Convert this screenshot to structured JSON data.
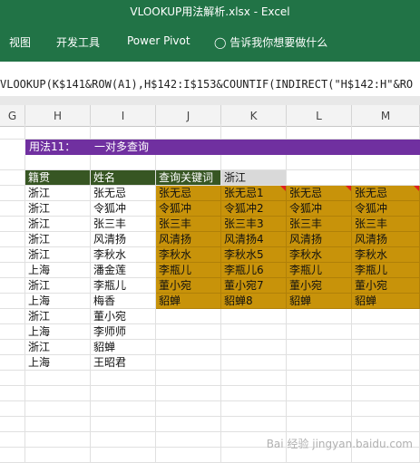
{
  "window": {
    "title": "VLOOKUP用法解析.xlsx  -  Excel"
  },
  "ribbon": {
    "tabs": [
      "视图",
      "开发工具",
      "Power Pivot"
    ],
    "tell_me": "告诉我你想要做什么"
  },
  "formula_bar": {
    "text": "VLOOKUP(K$141&ROW(A1),H$142:I$153&COUNTIF(INDIRECT(\"H$142:H\"&RO"
  },
  "columns": [
    "G",
    "H",
    "I",
    "J",
    "K",
    "L",
    "M"
  ],
  "sheet": {
    "section_label": "用法11：",
    "section_title": "一对多查询",
    "headers": {
      "h": "籍贯",
      "i": "姓名",
      "j": "查询关键词",
      "k": "浙江"
    },
    "data": [
      {
        "h": "浙江",
        "i": "张无忌"
      },
      {
        "h": "浙江",
        "i": "令狐冲"
      },
      {
        "h": "浙江",
        "i": "张三丰"
      },
      {
        "h": "浙江",
        "i": "风清扬"
      },
      {
        "h": "浙江",
        "i": "李秋水"
      },
      {
        "h": "上海",
        "i": "潘金莲"
      },
      {
        "h": "浙江",
        "i": "李瓶儿"
      },
      {
        "h": "上海",
        "i": "梅香"
      },
      {
        "h": "浙江",
        "i": "董小宛"
      },
      {
        "h": "上海",
        "i": "李师师"
      },
      {
        "h": "浙江",
        "i": "貂蝉"
      },
      {
        "h": "上海",
        "i": "王昭君"
      }
    ],
    "results": {
      "j": [
        "张无忌",
        "令狐冲",
        "张三丰",
        "风清扬",
        "李秋水",
        "李瓶儿",
        "董小宛",
        "貂蝉"
      ],
      "k": [
        "张无忌1",
        "令狐冲2",
        "张三丰3",
        "风清扬4",
        "李秋水5",
        "李瓶儿6",
        "董小宛7",
        "貂蝉8"
      ],
      "l": [
        "张无忌",
        "令狐冲",
        "张三丰",
        "风清扬",
        "李秋水",
        "李瓶儿",
        "董小宛",
        "貂蝉"
      ],
      "m": [
        "张无忌",
        "令狐冲",
        "张三丰",
        "风清扬",
        "李秋水",
        "李瓶儿",
        "董小宛",
        "貂蝉"
      ]
    }
  },
  "colors": {
    "ribbon": "#217346",
    "section": "#7030a0",
    "header": "#375623",
    "result": "#c8930a"
  },
  "watermark": "Bai 经验 jingyan.baidu.com"
}
